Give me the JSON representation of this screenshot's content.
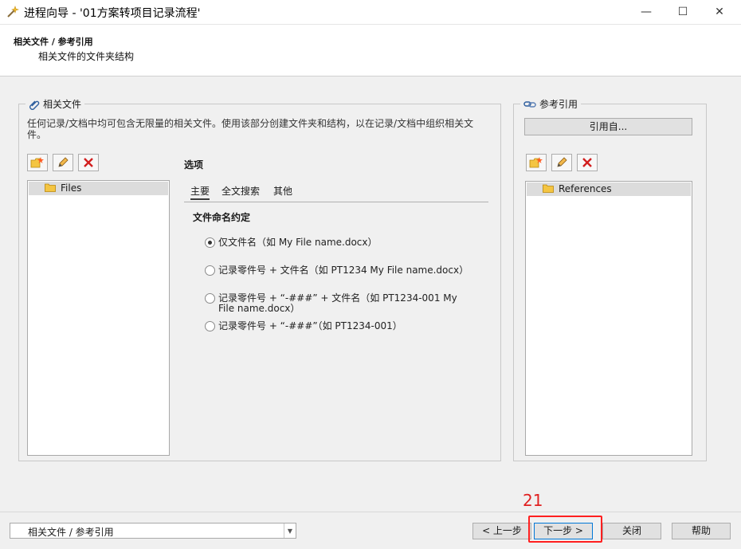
{
  "window": {
    "title": "进程向导 - '01方案转项目记录流程'",
    "min_glyph": "—",
    "max_glyph": "☐",
    "close_glyph": "✕"
  },
  "header": {
    "breadcrumb": "相关文件 / 参考引用",
    "subtitle": "相关文件的文件夹结构"
  },
  "related_files": {
    "legend": "相关文件",
    "description": "任何记录/文档中均可包含无限量的相关文件。使用该部分创建文件夹和结构，以在记录/文档中组织相关文件。",
    "tree": [
      {
        "label": "Files",
        "selected": true
      }
    ]
  },
  "options": {
    "title": "选项",
    "tabs": [
      {
        "label": "主要",
        "active": true
      },
      {
        "label": "全文搜索",
        "active": false
      },
      {
        "label": "其他",
        "active": false
      }
    ],
    "section_title": "文件命名约定",
    "radios": [
      {
        "label": "仅文件名（如 My File name.docx）",
        "checked": true
      },
      {
        "label": "记录零件号 + 文件名（如 PT1234 My File name.docx）",
        "checked": false
      },
      {
        "label": "记录零件号 + “-###” + 文件名（如 PT1234-001 My File name.docx）",
        "checked": false
      },
      {
        "label": "记录零件号 + “-###”（如 PT1234-001）",
        "checked": false
      }
    ]
  },
  "references": {
    "legend": "参考引用",
    "reference_from_button": "引用自...",
    "tree": [
      {
        "label": "References",
        "selected": true
      }
    ]
  },
  "footer": {
    "step_select_value": "相关文件 / 参考引用",
    "prev_button": "< 上一步",
    "next_button": "下一步 >",
    "close_button": "关闭",
    "help_button": "帮助"
  },
  "annotation": {
    "step_number": "21",
    "highlight_color": "#ff1f1f"
  }
}
